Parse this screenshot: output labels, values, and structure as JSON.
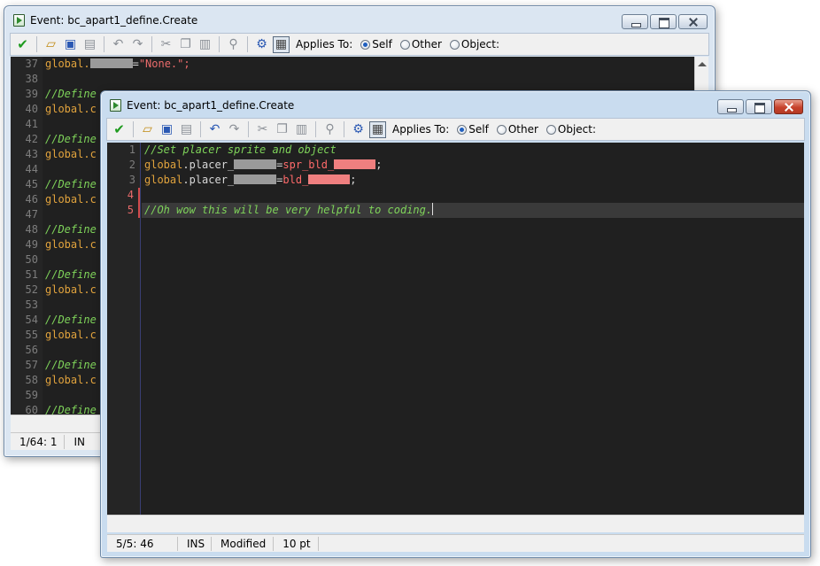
{
  "back_window": {
    "title": "Event: bc_apart1_define.Create",
    "toolbar": {
      "applies_to_label": "Applies To:",
      "self_label": "Self",
      "other_label": "Other",
      "object_label": "Object:",
      "selected": "Self"
    },
    "line_numbers": [
      "37",
      "38",
      "39",
      "40",
      "41",
      "42",
      "43",
      "44",
      "45",
      "46",
      "47",
      "48",
      "49",
      "50",
      "51",
      "52",
      "53",
      "54",
      "55",
      "56",
      "57",
      "58",
      "59",
      "60"
    ],
    "line37": {
      "prefix": "global.",
      "suffix": "=",
      "value": "\"None.\";"
    },
    "comment_fragment": "//Define",
    "global_fragment": "global.c",
    "status": {
      "position": "1/64:",
      "column": "1",
      "mode": "IN"
    }
  },
  "front_window": {
    "title": "Event: bc_apart1_define.Create",
    "toolbar": {
      "applies_to_label": "Applies To:",
      "self_label": "Self",
      "other_label": "Other",
      "object_label": "Object:",
      "selected": "Self"
    },
    "line_numbers": [
      "1",
      "2",
      "3",
      "4",
      "5"
    ],
    "code": {
      "line1": "//Set placer sprite and object",
      "line2_prefix": "global",
      "line2_member": ".placer_",
      "line2_assign": "=",
      "line2_value": "spr_bld_",
      "line2_end": ";",
      "line3_prefix": "global",
      "line3_member": ".placer_",
      "line3_assign": "=",
      "line3_value": "bld_",
      "line3_end": ";",
      "line5": "//Oh wow this will be very helpful to coding."
    },
    "status": {
      "position": "5/5:",
      "column": "46",
      "mode": "INS",
      "modified": "Modified",
      "font_size": "10 pt"
    }
  },
  "colors": {
    "editor_bg": "#202020",
    "comment": "#7fd45a",
    "keyword": "#e1a33d",
    "string": "#ea6b6b",
    "line_number": "#7d7d7d"
  }
}
